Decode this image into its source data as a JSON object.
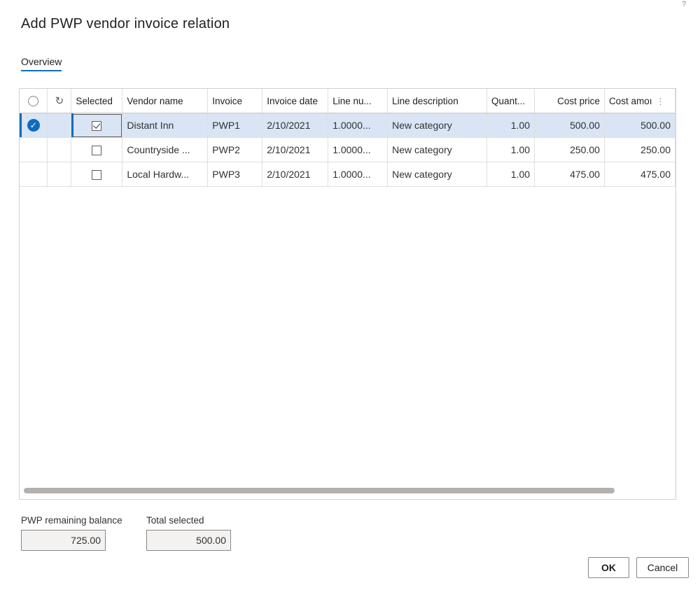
{
  "dialog": {
    "title": "Add PWP vendor invoice relation",
    "help_glyph": "?",
    "tab": "Overview"
  },
  "grid": {
    "columns": {
      "selected": "Selected",
      "vendor_name": "Vendor name",
      "invoice": "Invoice",
      "invoice_date": "Invoice date",
      "line_number": "Line nu...",
      "line_description": "Line description",
      "quantity": "Quant...",
      "cost_price": "Cost price",
      "cost_amount": "Cost amoı"
    },
    "rows": [
      {
        "selected": true,
        "vendor_name": "Distant Inn",
        "invoice": "PWP1",
        "invoice_date": "2/10/2021",
        "line_number": "1.0000...",
        "line_description": "New category",
        "quantity": "1.00",
        "cost_price": "500.00",
        "cost_amount": "500.00",
        "row_selected": true
      },
      {
        "selected": false,
        "vendor_name": "Countryside ...",
        "invoice": "PWP2",
        "invoice_date": "2/10/2021",
        "line_number": "1.0000...",
        "line_description": "New category",
        "quantity": "1.00",
        "cost_price": "250.00",
        "cost_amount": "250.00",
        "row_selected": false
      },
      {
        "selected": false,
        "vendor_name": "Local Hardw...",
        "invoice": "PWP3",
        "invoice_date": "2/10/2021",
        "line_number": "1.0000...",
        "line_description": "New category",
        "quantity": "1.00",
        "cost_price": "475.00",
        "cost_amount": "475.00",
        "row_selected": false
      }
    ]
  },
  "summary": {
    "remaining_label": "PWP remaining balance",
    "remaining_value": "725.00",
    "total_label": "Total selected",
    "total_value": "500.00"
  },
  "buttons": {
    "ok": "OK",
    "cancel": "Cancel"
  },
  "colors": {
    "accent": "#0f6cbd",
    "selected_row": "#d9e5f5"
  }
}
